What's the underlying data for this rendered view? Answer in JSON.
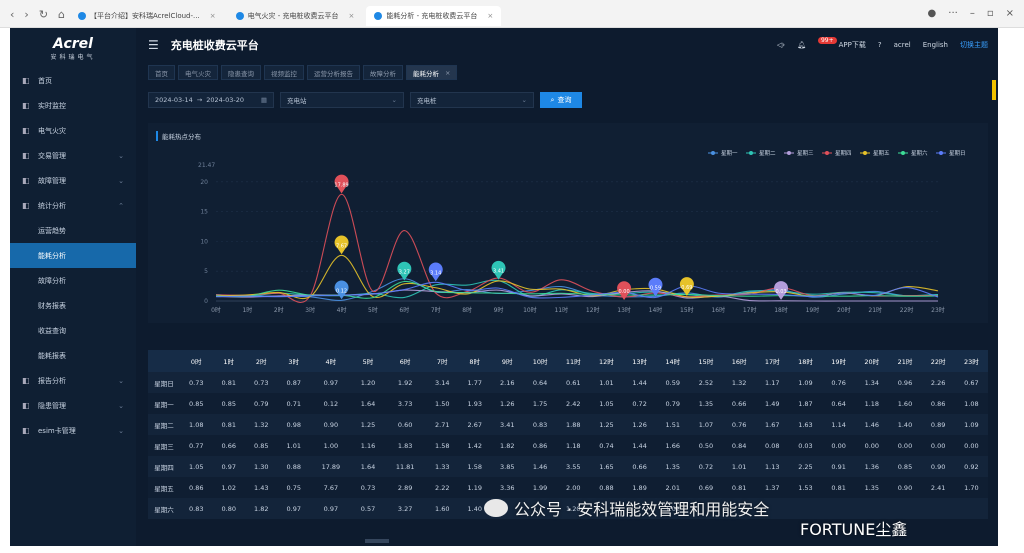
{
  "browser": {
    "tabs": [
      {
        "label": "【平台介绍】安科瑞AcrelCloud-..."
      },
      {
        "label": "电气火灾 - 充电桩收费云平台"
      },
      {
        "label": "能耗分析 - 充电桩收费云平台"
      }
    ]
  },
  "logo": {
    "brand": "Acrel",
    "sub": "安科瑞电气"
  },
  "header": {
    "title": "充电桩收费云平台",
    "badge": "99+",
    "app_download": "APP下载",
    "user": "acrel",
    "lang": "English",
    "switch_theme": "切换主题"
  },
  "sidebar": {
    "items": [
      {
        "label": "首页",
        "icon": "home-icon"
      },
      {
        "label": "实时监控",
        "icon": "monitor-icon"
      },
      {
        "label": "电气火灾",
        "icon": "fire-icon"
      },
      {
        "label": "交易管理",
        "icon": "trade-icon",
        "chevron": "⌄"
      },
      {
        "label": "故障管理",
        "icon": "fault-icon",
        "chevron": "⌄"
      },
      {
        "label": "统计分析",
        "icon": "stats-icon",
        "chevron": "⌃"
      },
      {
        "label": "运营趋势",
        "sub": true
      },
      {
        "label": "能耗分析",
        "sub": true,
        "active": true
      },
      {
        "label": "故障分析",
        "sub": true
      },
      {
        "label": "财务报表",
        "sub": true
      },
      {
        "label": "收益查询",
        "sub": true
      },
      {
        "label": "能耗报表",
        "sub": true
      },
      {
        "label": "报告分析",
        "icon": "report-icon",
        "chevron": "⌄"
      },
      {
        "label": "隐患管理",
        "icon": "warning-icon",
        "chevron": "⌄"
      },
      {
        "label": "esim卡管理",
        "icon": "sim-icon",
        "chevron": "⌄"
      }
    ]
  },
  "page_tabs": [
    {
      "label": "首页"
    },
    {
      "label": "电气火灾"
    },
    {
      "label": "隐患查询"
    },
    {
      "label": "视频监控"
    },
    {
      "label": "运营分析报告"
    },
    {
      "label": "故障分析"
    },
    {
      "label": "能耗分析",
      "active": true
    }
  ],
  "filters": {
    "date_start": "2024-03-14",
    "date_sep": "→",
    "date_end": "2024-03-20",
    "station": "充电站",
    "pile": "充电桩",
    "query": "查询"
  },
  "chart_panel": {
    "title": "能耗热点分布"
  },
  "chart_data": {
    "type": "line",
    "categories": [
      "0时",
      "1时",
      "2时",
      "3时",
      "4时",
      "5时",
      "6时",
      "7时",
      "8时",
      "9时",
      "10时",
      "11时",
      "12时",
      "13时",
      "14时",
      "15时",
      "16时",
      "17时",
      "18时",
      "19时",
      "20时",
      "21时",
      "22时",
      "23时"
    ],
    "ymax_label": "21.47",
    "yticks": [
      0,
      5,
      10,
      15,
      20
    ],
    "ylim": [
      0,
      21.47
    ],
    "legend_position": "top-right",
    "series": [
      {
        "name": "星期一",
        "color": "#4a90e2",
        "values": [
          0.85,
          0.85,
          0.79,
          0.71,
          0.12,
          1.64,
          3.73,
          1.5,
          1.93,
          1.26,
          1.75,
          2.42,
          1.05,
          0.72,
          0.79,
          1.35,
          0.66,
          1.49,
          1.87,
          0.64,
          1.18,
          1.6,
          0.86,
          1.08
        ]
      },
      {
        "name": "星期二",
        "color": "#2ec4b6",
        "values": [
          1.08,
          0.81,
          1.32,
          0.98,
          0.9,
          1.25,
          0.6,
          2.71,
          2.67,
          3.41,
          0.83,
          1.88,
          1.25,
          1.26,
          1.51,
          1.07,
          0.76,
          1.67,
          1.63,
          1.14,
          1.46,
          1.4,
          0.89,
          1.09
        ]
      },
      {
        "name": "星期三",
        "color": "#b39ddb",
        "values": [
          0.77,
          0.66,
          0.85,
          1.01,
          1.0,
          1.16,
          1.83,
          1.58,
          1.42,
          1.82,
          0.86,
          1.18,
          0.74,
          1.44,
          1.66,
          0.5,
          0.84,
          0.08,
          0.03,
          0.0,
          0.0,
          0.0,
          0.0,
          0.0
        ]
      },
      {
        "name": "星期四",
        "color": "#e0505a",
        "values": [
          1.05,
          0.97,
          1.3,
          0.88,
          17.89,
          1.64,
          11.81,
          1.33,
          1.58,
          3.85,
          1.46,
          3.55,
          1.65,
          0.66,
          1.35,
          0.72,
          1.01,
          1.13,
          2.25,
          0.91,
          1.36,
          0.85,
          0.9,
          0.92
        ]
      },
      {
        "name": "星期五",
        "color": "#e6c229",
        "values": [
          0.86,
          1.02,
          1.43,
          0.75,
          7.67,
          0.73,
          2.89,
          2.22,
          1.19,
          3.36,
          1.99,
          2.0,
          0.88,
          1.89,
          2.01,
          0.69,
          0.81,
          1.37,
          1.53,
          0.81,
          1.35,
          0.9,
          2.41,
          1.7
        ]
      },
      {
        "name": "星期六",
        "color": "#3ddc97",
        "values": [
          0.83,
          0.8,
          1.82,
          0.97,
          0.97,
          0.57,
          3.27,
          1.6,
          1.4,
          1.32,
          1.2,
          1.3,
          1.1,
          1.02,
          1.0,
          1.1,
          0.9,
          0.8,
          0.9,
          0.85,
          0.8,
          0.9,
          0.8,
          0.85
        ]
      },
      {
        "name": "星期日",
        "color": "#5b7cfa",
        "values": [
          0.73,
          0.81,
          0.73,
          0.87,
          0.97,
          1.2,
          1.92,
          3.14,
          1.77,
          2.16,
          0.64,
          0.61,
          1.01,
          1.44,
          0.59,
          2.52,
          1.32,
          1.17,
          1.09,
          0.76,
          1.34,
          0.96,
          2.26,
          0.67
        ]
      }
    ],
    "markers": [
      {
        "label": "17.89",
        "hour": 4,
        "value": 17.89,
        "color": "#e0505a"
      },
      {
        "label": "7.67",
        "hour": 4,
        "value": 7.67,
        "color": "#e6c229"
      },
      {
        "label": "0.12",
        "hour": 4,
        "value": 0.12,
        "color": "#4a90e2"
      },
      {
        "label": "3.27",
        "hour": 6,
        "value": 3.27,
        "color": "#2ec4b6"
      },
      {
        "label": "3.14",
        "hour": 7,
        "value": 3.14,
        "color": "#5b7cfa"
      },
      {
        "label": "3.41",
        "hour": 9,
        "value": 3.41,
        "color": "#2ec4b6"
      },
      {
        "label": "0.00",
        "hour": 13,
        "value": 0.0,
        "color": "#e0505a"
      },
      {
        "label": "0.59",
        "hour": 14,
        "value": 0.59,
        "color": "#5b7cfa"
      },
      {
        "label": "0.69",
        "hour": 15,
        "value": 0.69,
        "color": "#e6c229"
      },
      {
        "label": "0.03",
        "hour": 18,
        "value": 0.03,
        "color": "#b39ddb"
      }
    ]
  },
  "table": {
    "headers": [
      "",
      "0时",
      "1时",
      "2时",
      "3时",
      "4时",
      "5时",
      "6时",
      "7时",
      "8时",
      "9时",
      "10时",
      "11时",
      "12时",
      "13时",
      "14时",
      "15时",
      "16时",
      "17时",
      "18时",
      "19时",
      "20时",
      "21时",
      "22时",
      "23时"
    ],
    "rows": [
      [
        "星期日",
        "0.73",
        "0.81",
        "0.73",
        "0.87",
        "0.97",
        "1.20",
        "1.92",
        "3.14",
        "1.77",
        "2.16",
        "0.64",
        "0.61",
        "1.01",
        "1.44",
        "0.59",
        "2.52",
        "1.32",
        "1.17",
        "1.09",
        "0.76",
        "1.34",
        "0.96",
        "2.26",
        "0.67"
      ],
      [
        "星期一",
        "0.85",
        "0.85",
        "0.79",
        "0.71",
        "0.12",
        "1.64",
        "3.73",
        "1.50",
        "1.93",
        "1.26",
        "1.75",
        "2.42",
        "1.05",
        "0.72",
        "0.79",
        "1.35",
        "0.66",
        "1.49",
        "1.87",
        "0.64",
        "1.18",
        "1.60",
        "0.86",
        "1.08"
      ],
      [
        "星期二",
        "1.08",
        "0.81",
        "1.32",
        "0.98",
        "0.90",
        "1.25",
        "0.60",
        "2.71",
        "2.67",
        "3.41",
        "0.83",
        "1.88",
        "1.25",
        "1.26",
        "1.51",
        "1.07",
        "0.76",
        "1.67",
        "1.63",
        "1.14",
        "1.46",
        "1.40",
        "0.89",
        "1.09"
      ],
      [
        "星期三",
        "0.77",
        "0.66",
        "0.85",
        "1.01",
        "1.00",
        "1.16",
        "1.83",
        "1.58",
        "1.42",
        "1.82",
        "0.86",
        "1.18",
        "0.74",
        "1.44",
        "1.66",
        "0.50",
        "0.84",
        "0.08",
        "0.03",
        "0.00",
        "0.00",
        "0.00",
        "0.00",
        "0.00"
      ],
      [
        "星期四",
        "1.05",
        "0.97",
        "1.30",
        "0.88",
        "17.89",
        "1.64",
        "11.81",
        "1.33",
        "1.58",
        "3.85",
        "1.46",
        "3.55",
        "1.65",
        "0.66",
        "1.35",
        "0.72",
        "1.01",
        "1.13",
        "2.25",
        "0.91",
        "1.36",
        "0.85",
        "0.90",
        "0.92"
      ],
      [
        "星期五",
        "0.86",
        "1.02",
        "1.43",
        "0.75",
        "7.67",
        "0.73",
        "2.89",
        "2.22",
        "1.19",
        "3.36",
        "1.99",
        "2.00",
        "0.88",
        "1.89",
        "2.01",
        "0.69",
        "0.81",
        "1.37",
        "1.53",
        "0.81",
        "1.35",
        "0.90",
        "2.41",
        "1.70"
      ],
      [
        "星期六",
        "0.83",
        "0.80",
        "1.82",
        "0.97",
        "0.97",
        "0.57",
        "3.27",
        "1.60",
        "1.40",
        "",
        "",
        "1.20",
        "",
        "",
        "1.02",
        "",
        "",
        "",
        "",
        "",
        "",
        "",
        "",
        ""
      ]
    ]
  },
  "watermark": {
    "text": "公众号 · 安科瑞能效管理和用能安全",
    "text2": "FORTUNE尘鑫"
  }
}
